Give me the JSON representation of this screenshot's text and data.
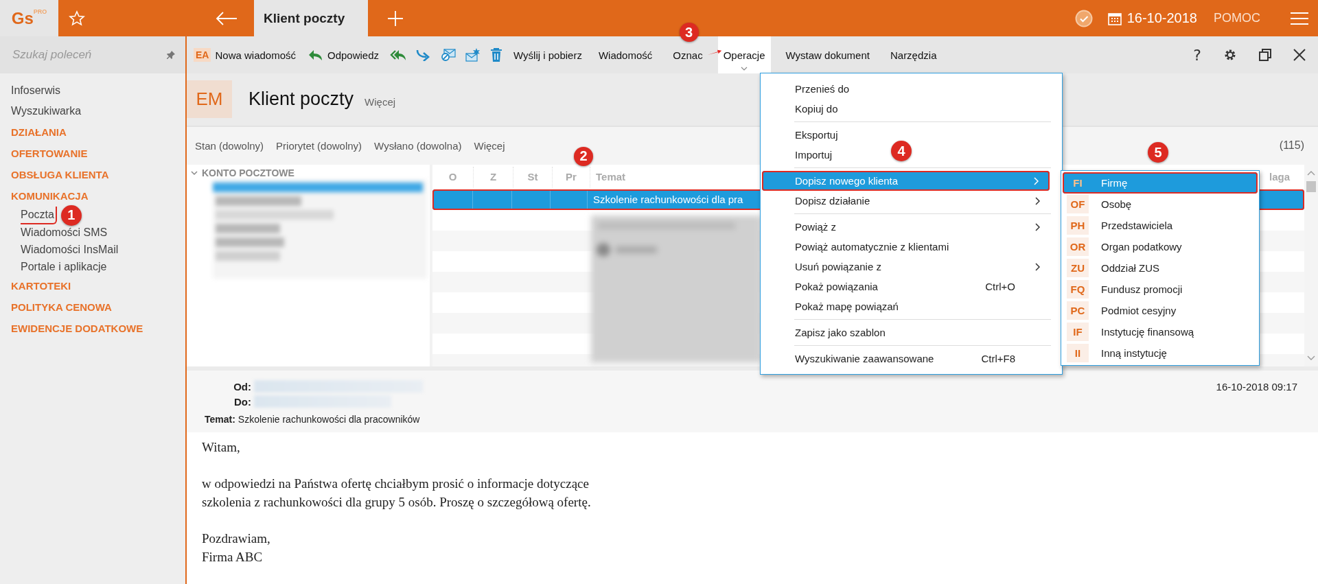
{
  "top_bar": {
    "logo": "Gs",
    "logo_sup": "PRO",
    "tab": "Klient poczty",
    "date": "16-10-2018",
    "help": "POMOC"
  },
  "search": {
    "placeholder": "Szukaj poleceń"
  },
  "toolbar": {
    "new_badge": "EA",
    "new_label": "Nowa wiadomość",
    "reply_label": "Odpowiedz",
    "send_receive": "Wyślij i pobierz",
    "menus": [
      {
        "label": "Wiadomość",
        "selected": false
      },
      {
        "label": "Oznac",
        "selected": false
      },
      {
        "label": "Operacje",
        "selected": true,
        "annotation": "3"
      },
      {
        "label": "Wystaw dokument",
        "selected": false
      },
      {
        "label": "Narzędzia",
        "selected": false
      }
    ],
    "help": "?"
  },
  "sidebar": [
    {
      "label": "Infoserwis",
      "kind": "link"
    },
    {
      "label": "Wyszukiwarka",
      "kind": "link"
    },
    {
      "label": "DZIAŁANIA",
      "kind": "section"
    },
    {
      "label": "OFERTOWANIE",
      "kind": "section"
    },
    {
      "label": "OBSŁUGA KLIENTA",
      "kind": "section"
    },
    {
      "label": "KOMUNIKACJA",
      "kind": "section",
      "children": [
        {
          "label": "Poczta",
          "annotation": "1"
        },
        {
          "label": "Wiadomości SMS"
        },
        {
          "label": "Wiadomości InsMail"
        },
        {
          "label": "Portale i aplikacje"
        }
      ]
    },
    {
      "label": "KARTOTEKI",
      "kind": "section"
    },
    {
      "label": "POLITYKA CENOWA",
      "kind": "section"
    },
    {
      "label": "EWIDENCJE DODATKOWE",
      "kind": "section"
    }
  ],
  "header": {
    "badge": "EM",
    "title": "Klient poczty",
    "more": "Więcej"
  },
  "filters": [
    "Stan (dowolny)",
    "Priorytet (dowolny)",
    "Wysłano (dowolna)",
    "Więcej"
  ],
  "count": "(115)",
  "folders": {
    "title": "KONTO POCZTOWE",
    "expanded": true
  },
  "message_list": {
    "columns": [
      "O",
      "Z",
      "St",
      "Pr",
      "Temat",
      "laga"
    ],
    "rows": [
      {
        "subject": "Szkolenie rachunkowości dla pra",
        "selected": true,
        "annotation": "2"
      }
    ]
  },
  "context_menu": {
    "groups": [
      [
        {
          "label": "Przenieś do",
          "submenu": false,
          "selected": false
        },
        {
          "label": "Kopiuj do",
          "submenu": false,
          "selected": false
        }
      ],
      [
        {
          "label": "Eksportuj",
          "submenu": false,
          "selected": false
        },
        {
          "label": "Importuj",
          "submenu": false,
          "selected": false
        }
      ],
      [
        {
          "label": "Dopisz nowego klienta",
          "submenu": true,
          "selected": true,
          "annotation": "4"
        },
        {
          "label": "Dopisz działanie",
          "submenu": true,
          "selected": false
        }
      ],
      [
        {
          "label": "Powiąż z",
          "submenu": true,
          "selected": false
        },
        {
          "label": "Powiąż automatycznie z klientami",
          "submenu": false,
          "selected": false
        },
        {
          "label": "Usuń powiązanie z",
          "submenu": true,
          "selected": false
        },
        {
          "label": "Pokaż powiązania",
          "shortcut": "Ctrl+O",
          "submenu": false,
          "selected": false
        },
        {
          "label": "Pokaż mapę powiązań",
          "submenu": false,
          "selected": false
        }
      ],
      [
        {
          "label": "Zapisz jako szablon",
          "submenu": false,
          "selected": false
        }
      ],
      [
        {
          "label": "Wyszukiwanie zaawansowane",
          "shortcut": "Ctrl+F8",
          "submenu": false,
          "selected": false
        }
      ]
    ]
  },
  "submenu": [
    {
      "code": "FI",
      "label": "Firmę",
      "selected": true,
      "annotation": "5"
    },
    {
      "code": "OF",
      "label": "Osobę",
      "selected": false
    },
    {
      "code": "PH",
      "label": "Przedstawiciela",
      "selected": false
    },
    {
      "code": "OR",
      "label": "Organ podatkowy",
      "selected": false
    },
    {
      "code": "ZU",
      "label": "Oddział ZUS",
      "selected": false
    },
    {
      "code": "FQ",
      "label": "Fundusz promocji",
      "selected": false
    },
    {
      "code": "PC",
      "label": "Podmiot cesyjny",
      "selected": false
    },
    {
      "code": "IF",
      "label": "Instytucję finansową",
      "selected": false
    },
    {
      "code": "II",
      "label": "Inną instytucję",
      "selected": false
    }
  ],
  "preview": {
    "from_label": "Od:",
    "to_label": "Do:",
    "subject_label": "Temat:",
    "subject": "Szkolenie rachunkowości dla pracowników",
    "date": "16-10-2018 09:17",
    "body": [
      [
        "Witam,"
      ],
      [
        "w odpowiedzi na Państwa ofertę chciałbym prosić o informacje dotyczące",
        "szkolenia z rachunkowości dla grupy 5 osób. Proszę o szczegółową ofertę."
      ],
      [
        "Pozdrawiam,",
        "Firma ABC"
      ]
    ]
  }
}
